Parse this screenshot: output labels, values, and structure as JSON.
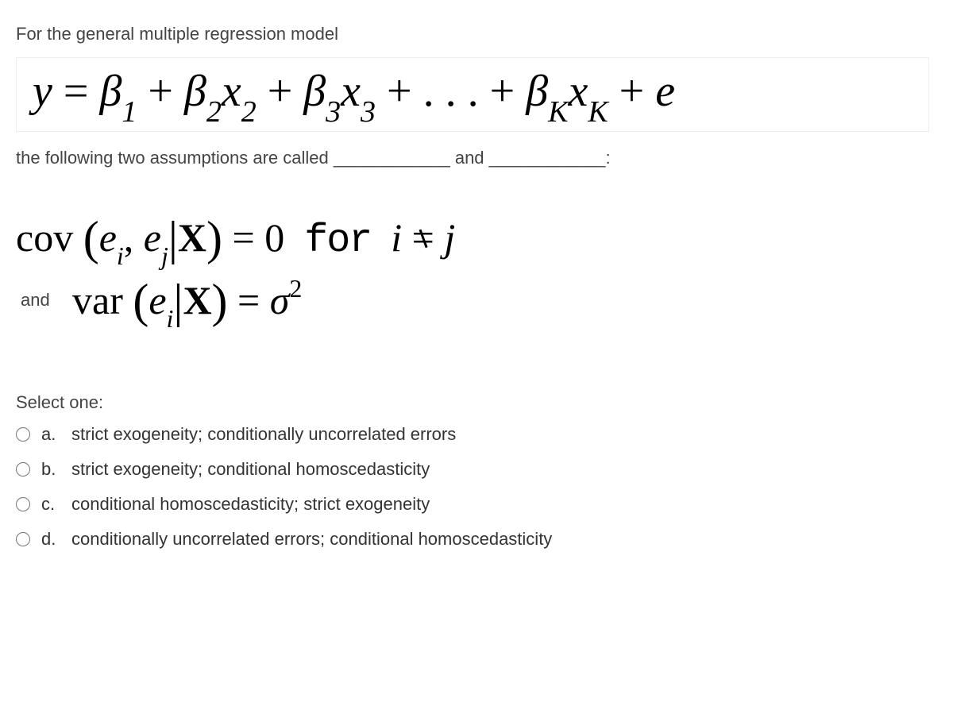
{
  "intro_text": "For the general multiple regression model",
  "equation": "y = β₁ + β₂x₂ + β₃x₃ + … + βKxK + e",
  "follow_text_1": "the following two assumptions are called ",
  "blank": "____________",
  "follow_text_mid": " and ",
  "follow_text_end": ":",
  "assumption1_text": "cov(eᵢ, eⱼ|X) = 0  for  i ≠ j",
  "and_label": "and",
  "assumption2_text": "var(eᵢ|X) = σ²",
  "select_label": "Select one:",
  "options": [
    {
      "letter": "a.",
      "text": "strict exogeneity; conditionally uncorrelated errors"
    },
    {
      "letter": "b.",
      "text": "strict exogeneity; conditional homoscedasticity"
    },
    {
      "letter": "c.",
      "text": "conditional homoscedasticity; strict exogeneity"
    },
    {
      "letter": "d.",
      "text": "conditionally uncorrelated errors; conditional homoscedasticity"
    }
  ]
}
